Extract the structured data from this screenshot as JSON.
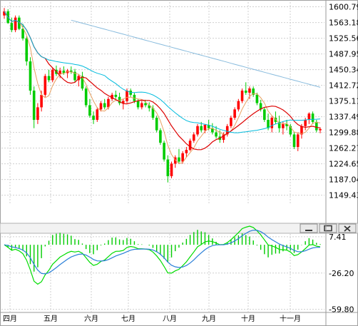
{
  "window_buttons": {
    "minimize": "minimize-icon",
    "maximize": "maximize-icon",
    "close": "close-icon"
  },
  "chart_data": [
    {
      "type": "candlestick",
      "panel": "price",
      "title": "",
      "ylim": [
        1130,
        1612
      ],
      "y_tick_labels": [
        "1600.79",
        "1563.18",
        "1525.56",
        "1487.95",
        "1450.34",
        "1412.72",
        "1375.11",
        "1337.49",
        "1299.88",
        "1262.27",
        "1224.65",
        "1187.04",
        "1149.43"
      ],
      "x_tick_labels": [
        "四月",
        "五月",
        "六月",
        "七月",
        "八月",
        "九月",
        "十月",
        "十一月"
      ],
      "grid": true,
      "colors": {
        "up": "#ff0000",
        "down": "#00cc00",
        "ma_short": "#e8a060",
        "ma_mid": "#dd0000",
        "ma_long1": "#00bbdd",
        "ma_long2": "#88bbdd"
      },
      "candles": [
        [
          1580,
          1598,
          1572,
          1590
        ],
        [
          1590,
          1595,
          1560,
          1562
        ],
        [
          1562,
          1575,
          1540,
          1545
        ],
        [
          1545,
          1580,
          1540,
          1575
        ],
        [
          1575,
          1580,
          1545,
          1548
        ],
        [
          1548,
          1560,
          1520,
          1525
        ],
        [
          1525,
          1530,
          1460,
          1470
        ],
        [
          1470,
          1480,
          1390,
          1400
        ],
        [
          1400,
          1410,
          1310,
          1330
        ],
        [
          1330,
          1370,
          1320,
          1360
        ],
        [
          1360,
          1400,
          1350,
          1390
        ],
        [
          1390,
          1440,
          1385,
          1435
        ],
        [
          1435,
          1450,
          1420,
          1425
        ],
        [
          1425,
          1455,
          1420,
          1450
        ],
        [
          1450,
          1460,
          1435,
          1440
        ],
        [
          1440,
          1455,
          1430,
          1448
        ],
        [
          1448,
          1458,
          1438,
          1442
        ],
        [
          1442,
          1452,
          1430,
          1448
        ],
        [
          1448,
          1458,
          1440,
          1445
        ],
        [
          1445,
          1452,
          1420,
          1425
        ],
        [
          1425,
          1440,
          1410,
          1435
        ],
        [
          1435,
          1445,
          1400,
          1405
        ],
        [
          1405,
          1410,
          1360,
          1365
        ],
        [
          1365,
          1380,
          1335,
          1340
        ],
        [
          1340,
          1350,
          1320,
          1330
        ],
        [
          1330,
          1360,
          1325,
          1355
        ],
        [
          1355,
          1375,
          1350,
          1370
        ],
        [
          1370,
          1380,
          1355,
          1360
        ],
        [
          1360,
          1385,
          1355,
          1380
        ],
        [
          1380,
          1395,
          1375,
          1390
        ],
        [
          1390,
          1400,
          1380,
          1385
        ],
        [
          1385,
          1395,
          1365,
          1370
        ],
        [
          1370,
          1380,
          1355,
          1375
        ],
        [
          1375,
          1405,
          1370,
          1400
        ],
        [
          1400,
          1405,
          1385,
          1390
        ],
        [
          1390,
          1395,
          1370,
          1375
        ],
        [
          1375,
          1380,
          1355,
          1360
        ],
        [
          1360,
          1375,
          1355,
          1370
        ],
        [
          1370,
          1378,
          1360,
          1365
        ],
        [
          1365,
          1372,
          1350,
          1358
        ],
        [
          1358,
          1365,
          1330,
          1335
        ],
        [
          1335,
          1340,
          1300,
          1305
        ],
        [
          1305,
          1310,
          1270,
          1275
        ],
        [
          1275,
          1280,
          1230,
          1235
        ],
        [
          1235,
          1245,
          1180,
          1195
        ],
        [
          1195,
          1230,
          1190,
          1225
        ],
        [
          1225,
          1245,
          1215,
          1240
        ],
        [
          1240,
          1260,
          1225,
          1230
        ],
        [
          1230,
          1255,
          1225,
          1250
        ],
        [
          1250,
          1265,
          1240,
          1258
        ],
        [
          1258,
          1285,
          1255,
          1280
        ],
        [
          1280,
          1300,
          1275,
          1295
        ],
        [
          1295,
          1320,
          1290,
          1315
        ],
        [
          1315,
          1325,
          1300,
          1305
        ],
        [
          1305,
          1320,
          1298,
          1318
        ],
        [
          1318,
          1330,
          1305,
          1310
        ],
        [
          1310,
          1322,
          1295,
          1300
        ],
        [
          1300,
          1315,
          1285,
          1290
        ],
        [
          1290,
          1305,
          1275,
          1282
        ],
        [
          1282,
          1300,
          1275,
          1295
        ],
        [
          1295,
          1320,
          1290,
          1315
        ],
        [
          1315,
          1340,
          1310,
          1335
        ],
        [
          1335,
          1360,
          1330,
          1355
        ],
        [
          1355,
          1380,
          1350,
          1375
        ],
        [
          1375,
          1405,
          1370,
          1400
        ],
        [
          1400,
          1420,
          1390,
          1395
        ],
        [
          1395,
          1410,
          1380,
          1405
        ],
        [
          1405,
          1410,
          1385,
          1390
        ],
        [
          1390,
          1395,
          1365,
          1370
        ],
        [
          1370,
          1378,
          1350,
          1355
        ],
        [
          1355,
          1360,
          1325,
          1330
        ],
        [
          1330,
          1345,
          1305,
          1310
        ],
        [
          1310,
          1340,
          1300,
          1335
        ],
        [
          1335,
          1350,
          1320,
          1325
        ],
        [
          1325,
          1340,
          1300,
          1310
        ],
        [
          1310,
          1325,
          1295,
          1320
        ],
        [
          1320,
          1330,
          1305,
          1315
        ],
        [
          1315,
          1320,
          1290,
          1295
        ],
        [
          1295,
          1300,
          1260,
          1265
        ],
        [
          1265,
          1300,
          1255,
          1295
        ],
        [
          1295,
          1320,
          1285,
          1315
        ],
        [
          1315,
          1335,
          1305,
          1330
        ],
        [
          1330,
          1348,
          1320,
          1345
        ],
        [
          1345,
          1350,
          1320,
          1325
        ],
        [
          1325,
          1330,
          1300,
          1305
        ],
        [
          1305,
          1312,
          1298,
          1308
        ]
      ]
    },
    {
      "type": "macd",
      "panel": "indicator",
      "title": "",
      "ylim": [
        -62,
        10
      ],
      "y_tick_labels": [
        "7.41",
        "-26.20",
        "-59.80"
      ],
      "grid": true,
      "colors": {
        "hist": "#00cc00",
        "line1": "#00dd00",
        "line2": "#2a7fd8"
      }
    }
  ]
}
